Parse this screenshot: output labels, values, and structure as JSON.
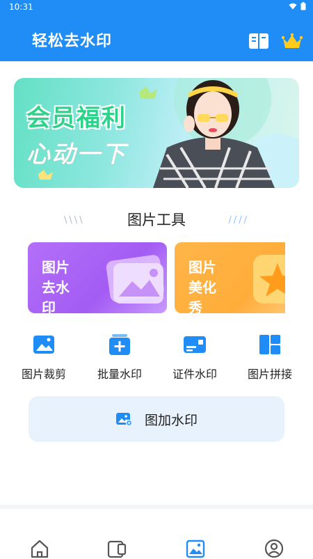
{
  "status_bar": {
    "time": "10:31"
  },
  "header": {
    "title": "轻松去水印",
    "book_icon": "book-icon",
    "vip_icon": "crown-icon"
  },
  "banner": {
    "line1": "会员福利",
    "line2": "心动一下"
  },
  "section": {
    "title": "图片工具",
    "deco_left": "\\\\\\\\",
    "deco_right": "////"
  },
  "cards": [
    {
      "label": "图片去水印",
      "color": "#b46ff8"
    },
    {
      "label": "图片美化秀",
      "color": "#ffb547"
    }
  ],
  "tools": [
    {
      "label": "图片裁剪",
      "icon": "image-crop-icon"
    },
    {
      "label": "批量水印",
      "icon": "batch-watermark-icon"
    },
    {
      "label": "证件水印",
      "icon": "id-card-icon"
    },
    {
      "label": "图片拼接",
      "icon": "grid-layout-icon"
    }
  ],
  "add_watermark": {
    "label": "图加水印",
    "icon": "image-add-icon"
  },
  "bottom_nav": [
    {
      "icon": "home-icon"
    },
    {
      "icon": "tablet-icon"
    },
    {
      "icon": "image-icon",
      "active": true
    },
    {
      "icon": "user-icon"
    }
  ],
  "colors": {
    "primary": "#1f8df5",
    "accent_bg": "#e8f2fd"
  }
}
